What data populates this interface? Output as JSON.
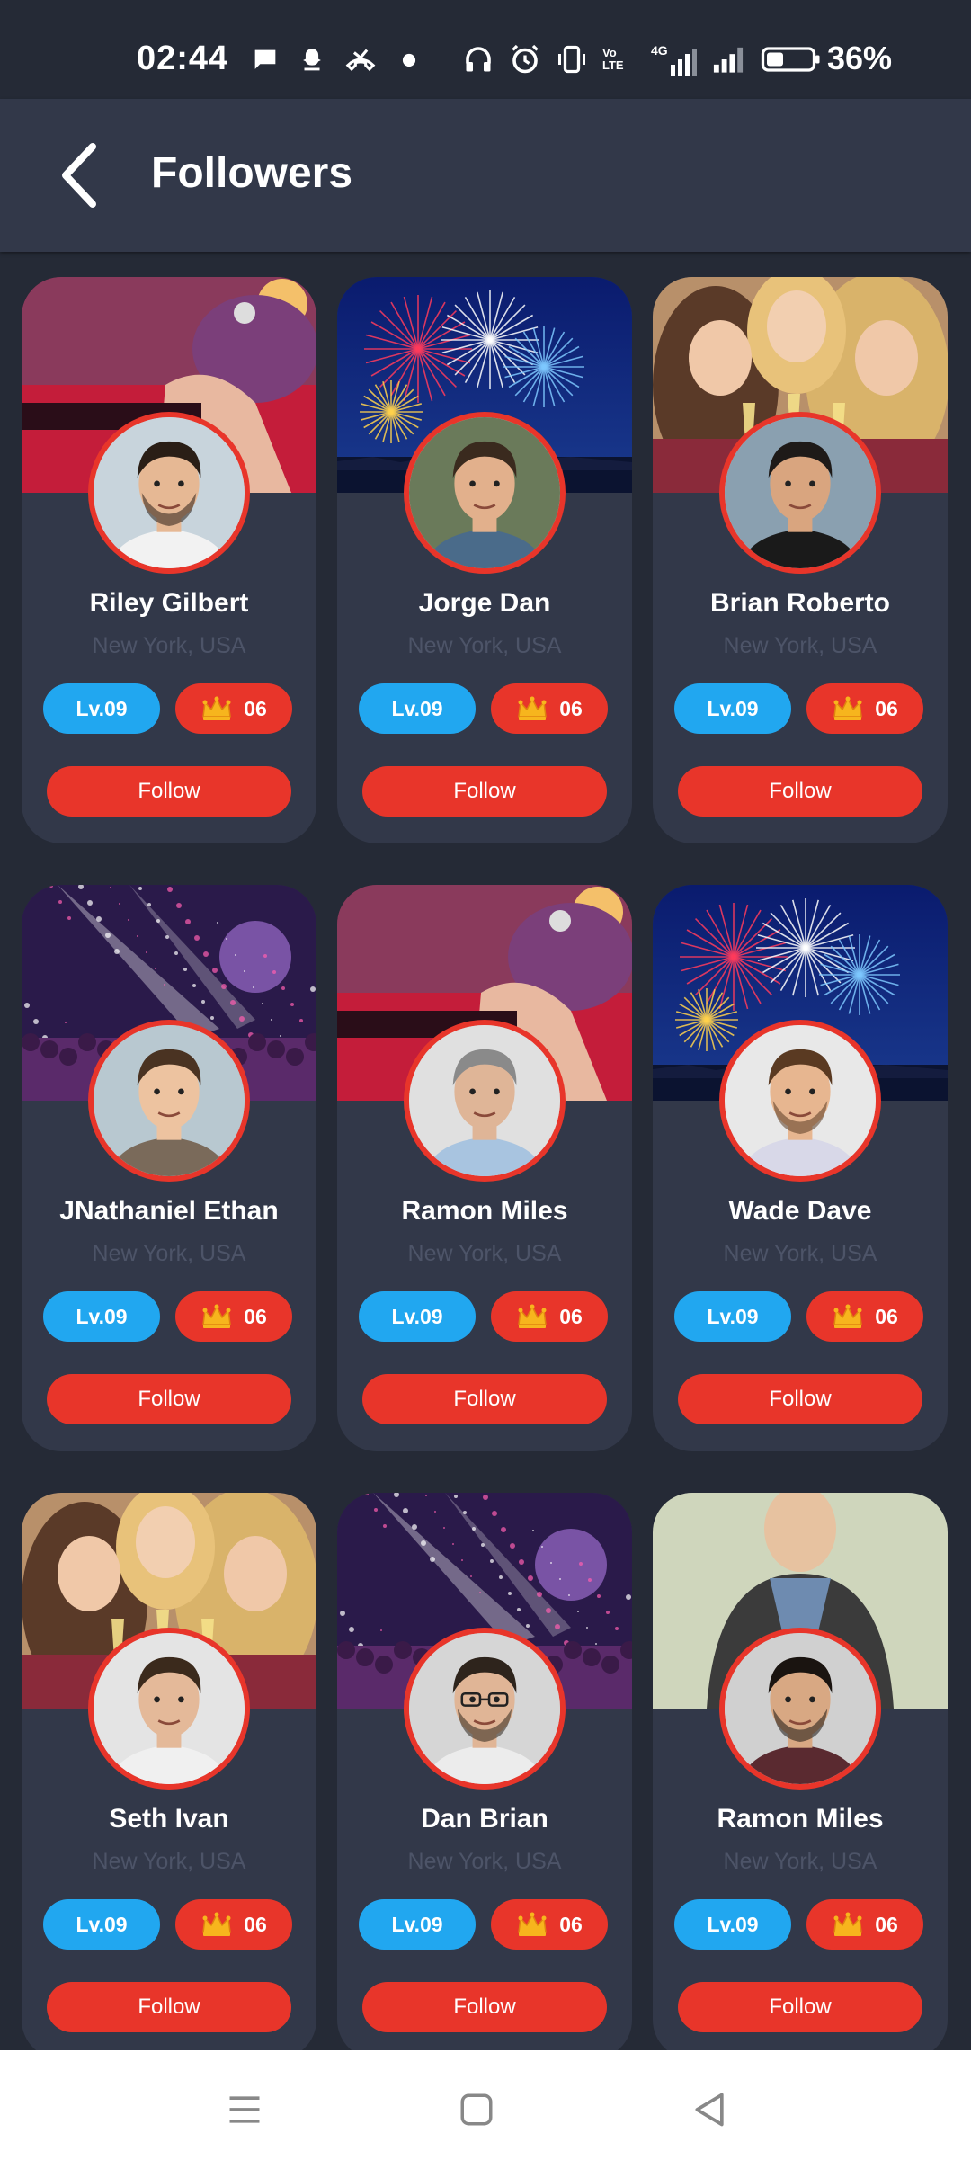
{
  "status_bar": {
    "time": "02:44",
    "battery_percent": "36%",
    "signal_labels": [
      "Vo LTE",
      "4G"
    ],
    "icons": [
      "message-icon",
      "snapchat-icon",
      "missed-call-icon",
      "dot-icon",
      "headphones-icon",
      "alarm-icon",
      "vibrate-icon",
      "volte-icon",
      "signal-4g-icon",
      "signal-icon",
      "battery-icon"
    ]
  },
  "header": {
    "title": "Followers",
    "back_icon": "back-arrow-icon"
  },
  "colors": {
    "background": "#252a36",
    "card": "#323849",
    "accent": "#e8352a",
    "level_badge": "#21a7f0"
  },
  "followers": [
    {
      "name": "Riley Gilbert",
      "location": "New York, USA",
      "level": "Lv.09",
      "crowns": "06",
      "button": "Follow",
      "cover": "concert-stage"
    },
    {
      "name": "Jorge Dan",
      "location": "New York, USA",
      "level": "Lv.09",
      "crowns": "06",
      "button": "Follow",
      "cover": "fireworks"
    },
    {
      "name": "Brian Roberto",
      "location": "New York, USA",
      "level": "Lv.09",
      "crowns": "06",
      "button": "Follow",
      "cover": "party-friends"
    },
    {
      "name": "JNathaniel Ethan",
      "location": "New York, USA",
      "level": "Lv.09",
      "crowns": "06",
      "button": "Follow",
      "cover": "club-lights"
    },
    {
      "name": "Ramon Miles",
      "location": "New York, USA",
      "level": "Lv.09",
      "crowns": "06",
      "button": "Follow",
      "cover": "concert-stage"
    },
    {
      "name": "Wade Dave",
      "location": "New York, USA",
      "level": "Lv.09",
      "crowns": "06",
      "button": "Follow",
      "cover": "fireworks"
    },
    {
      "name": "Seth Ivan",
      "location": "New York, USA",
      "level": "Lv.09",
      "crowns": "06",
      "button": "Follow",
      "cover": "party-friends"
    },
    {
      "name": "Dan Brian",
      "location": "New York, USA",
      "level": "Lv.09",
      "crowns": "06",
      "button": "Follow",
      "cover": "club-lights"
    },
    {
      "name": "Ramon Miles",
      "location": "New York, USA",
      "level": "Lv.09",
      "crowns": "06",
      "button": "Follow",
      "cover": "man-jacket"
    }
  ],
  "nav": {
    "icons": [
      "menu-icon",
      "home-icon",
      "back-icon"
    ]
  }
}
